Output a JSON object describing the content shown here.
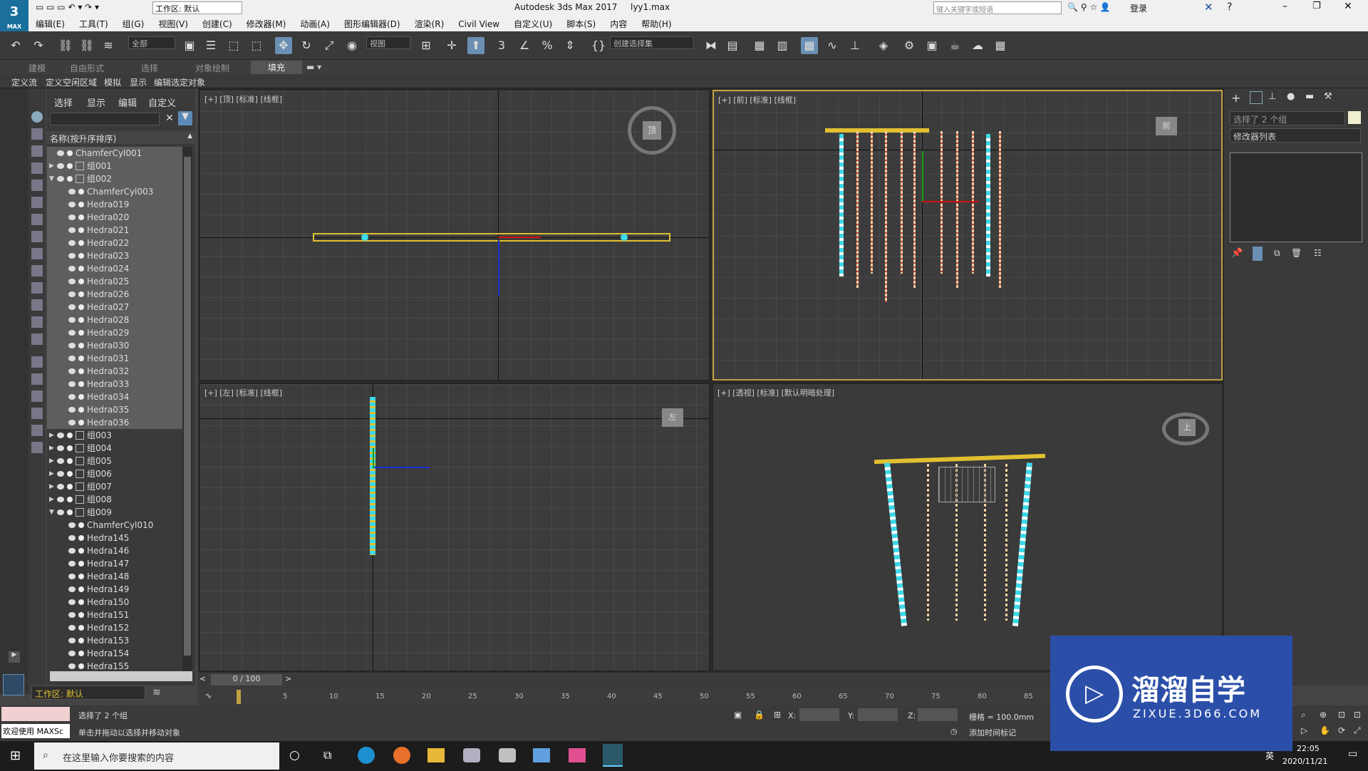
{
  "window": {
    "title": "Autodesk 3ds Max 2017",
    "file": "lyy1.max",
    "workspace": "工作区: 默认",
    "search_placeholder": "键入关键字或短语",
    "login": "登录"
  },
  "logo": {
    "text": "3",
    "sub": "MAX"
  },
  "menu": [
    "编辑(E)",
    "工具(T)",
    "组(G)",
    "视图(V)",
    "创建(C)",
    "修改器(M)",
    "动画(A)",
    "图形编辑器(D)",
    "渲染(R)",
    "Civil View",
    "自定义(U)",
    "脚本(S)",
    "内容",
    "帮助(H)"
  ],
  "toolbar": {
    "filter": "全部",
    "refcoord": "视图",
    "selset": "创建选择集"
  },
  "ribbon": {
    "tabs": [
      "建模",
      "自由形式",
      "选择",
      "对象绘制",
      "填充"
    ],
    "sub": [
      "定义流",
      "定义空闲区域",
      "模拟",
      "显示",
      "编辑选定对象"
    ]
  },
  "scene": {
    "menu": [
      "选择",
      "显示",
      "编辑",
      "自定义"
    ],
    "header": "名称(按升序排序)",
    "rows": [
      {
        "name": "ChamferCyl001",
        "indent": 0,
        "tog": "",
        "sel": true
      },
      {
        "name": "组001",
        "indent": 0,
        "tog": "▶",
        "sel": true
      },
      {
        "name": "组002",
        "indent": 0,
        "tog": "▼",
        "sel": true
      },
      {
        "name": "ChamferCyl003",
        "indent": 1,
        "tog": "",
        "sel": true
      },
      {
        "name": "Hedra019",
        "indent": 1,
        "tog": "",
        "sel": true
      },
      {
        "name": "Hedra020",
        "indent": 1,
        "tog": "",
        "sel": true
      },
      {
        "name": "Hedra021",
        "indent": 1,
        "tog": "",
        "sel": true
      },
      {
        "name": "Hedra022",
        "indent": 1,
        "tog": "",
        "sel": true
      },
      {
        "name": "Hedra023",
        "indent": 1,
        "tog": "",
        "sel": true
      },
      {
        "name": "Hedra024",
        "indent": 1,
        "tog": "",
        "sel": true
      },
      {
        "name": "Hedra025",
        "indent": 1,
        "tog": "",
        "sel": true
      },
      {
        "name": "Hedra026",
        "indent": 1,
        "tog": "",
        "sel": true
      },
      {
        "name": "Hedra027",
        "indent": 1,
        "tog": "",
        "sel": true
      },
      {
        "name": "Hedra028",
        "indent": 1,
        "tog": "",
        "sel": true
      },
      {
        "name": "Hedra029",
        "indent": 1,
        "tog": "",
        "sel": true
      },
      {
        "name": "Hedra030",
        "indent": 1,
        "tog": "",
        "sel": true
      },
      {
        "name": "Hedra031",
        "indent": 1,
        "tog": "",
        "sel": true
      },
      {
        "name": "Hedra032",
        "indent": 1,
        "tog": "",
        "sel": true
      },
      {
        "name": "Hedra033",
        "indent": 1,
        "tog": "",
        "sel": true
      },
      {
        "name": "Hedra034",
        "indent": 1,
        "tog": "",
        "sel": true
      },
      {
        "name": "Hedra035",
        "indent": 1,
        "tog": "",
        "sel": true
      },
      {
        "name": "Hedra036",
        "indent": 1,
        "tog": "",
        "sel": true
      },
      {
        "name": "组003",
        "indent": 0,
        "tog": "▶",
        "sel": false
      },
      {
        "name": "组004",
        "indent": 0,
        "tog": "▶",
        "sel": false
      },
      {
        "name": "组005",
        "indent": 0,
        "tog": "▶",
        "sel": false
      },
      {
        "name": "组006",
        "indent": 0,
        "tog": "▶",
        "sel": false
      },
      {
        "name": "组007",
        "indent": 0,
        "tog": "▶",
        "sel": false
      },
      {
        "name": "组008",
        "indent": 0,
        "tog": "▶",
        "sel": false
      },
      {
        "name": "组009",
        "indent": 0,
        "tog": "▼",
        "sel": false
      },
      {
        "name": "ChamferCyl010",
        "indent": 1,
        "tog": "",
        "sel": false
      },
      {
        "name": "Hedra145",
        "indent": 1,
        "tog": "",
        "sel": false
      },
      {
        "name": "Hedra146",
        "indent": 1,
        "tog": "",
        "sel": false
      },
      {
        "name": "Hedra147",
        "indent": 1,
        "tog": "",
        "sel": false
      },
      {
        "name": "Hedra148",
        "indent": 1,
        "tog": "",
        "sel": false
      },
      {
        "name": "Hedra149",
        "indent": 1,
        "tog": "",
        "sel": false
      },
      {
        "name": "Hedra150",
        "indent": 1,
        "tog": "",
        "sel": false
      },
      {
        "name": "Hedra151",
        "indent": 1,
        "tog": "",
        "sel": false
      },
      {
        "name": "Hedra152",
        "indent": 1,
        "tog": "",
        "sel": false
      },
      {
        "name": "Hedra153",
        "indent": 1,
        "tog": "",
        "sel": false
      },
      {
        "name": "Hedra154",
        "indent": 1,
        "tog": "",
        "sel": false
      },
      {
        "name": "Hedra155",
        "indent": 1,
        "tog": "",
        "sel": false
      }
    ],
    "workspace": "工作区: 默认"
  },
  "viewports": {
    "top": "[+] [顶] [标准] [线框]",
    "front": "[+] [前] [标准] [线框]",
    "left": "[+] [左] [标准] [线框]",
    "persp": "[+] [透视] [标准] [默认明暗处理]",
    "cube_top": "顶",
    "cube_front": "前",
    "cube_left": "左",
    "cube_persp": "上"
  },
  "cmd": {
    "selection": "选择了 2 个组",
    "modlist": "修改器列表"
  },
  "time": {
    "slider": "0 / 100",
    "ticks": [
      "0",
      "5",
      "10",
      "15",
      "20",
      "25",
      "30",
      "35",
      "40",
      "45",
      "50",
      "55",
      "60",
      "65",
      "70",
      "75",
      "80",
      "85"
    ]
  },
  "status": {
    "selected": "选择了 2 个组",
    "hint": "单击并拖动以选择并移动对象",
    "welcome": "欢迎使用 MAXSc",
    "x": "X:",
    "y": "Y:",
    "z": "Z:",
    "grid": "栅格 = 100.0mm",
    "addtime": "添加时间标记"
  },
  "taskbar": {
    "search": "在这里输入你要搜索的内容",
    "time": "22:05",
    "date": "2020/11/21",
    "ime": "英"
  },
  "watermark": {
    "name": "溜溜自学",
    "url": "ZIXUE.3D66.COM"
  },
  "colors": {
    "selection": "#e0c030",
    "accent": "#6a8fb3",
    "brand": "#2b4fa8"
  }
}
